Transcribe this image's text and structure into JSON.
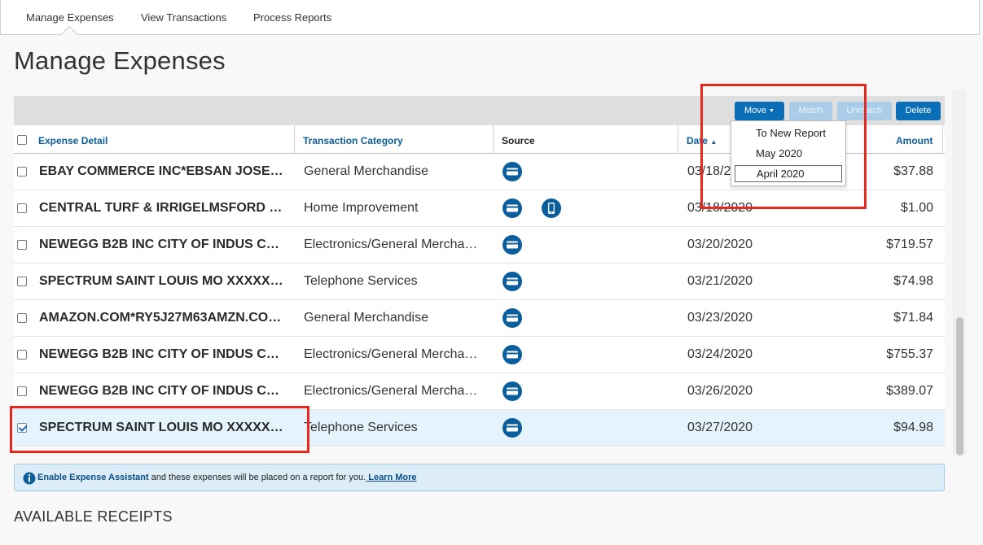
{
  "nav": {
    "tabs": [
      "Manage Expenses",
      "View Transactions",
      "Process Reports"
    ]
  },
  "page": {
    "title": "Manage Expenses",
    "section_title": "AVAILABLE RECEIPTS"
  },
  "toolbar": {
    "move_label": "Move",
    "match_label": "Match",
    "unmatch_label": "Unmatch",
    "delete_label": "Delete"
  },
  "move_menu": {
    "options": [
      "To New Report",
      "May 2020",
      "April 2020"
    ],
    "focused": "April 2020"
  },
  "table": {
    "headers": {
      "detail": "Expense Detail",
      "category": "Transaction Category",
      "source": "Source",
      "date": "Date",
      "amount": "Amount"
    },
    "sort": {
      "column": "Date",
      "direction": "ascending"
    },
    "rows": [
      {
        "detail": "EBAY COMMERCE INC*EBSAN JOSE…",
        "category": "General Merchandise",
        "sources": [
          "card-icon"
        ],
        "date": "03/18/2020",
        "amount": "$37.88",
        "checked": false
      },
      {
        "detail": "CENTRAL TURF & IRRIGELMSFORD …",
        "category": "Home Improvement",
        "sources": [
          "card-icon",
          "mobile-icon"
        ],
        "date": "03/18/2020",
        "amount": "$1.00",
        "checked": false
      },
      {
        "detail": "NEWEGG B2B INC CITY OF INDUS C…",
        "category": "Electronics/General Mercha…",
        "sources": [
          "card-icon"
        ],
        "date": "03/20/2020",
        "amount": "$719.57",
        "checked": false
      },
      {
        "detail": "SPECTRUM SAINT LOUIS MO XXXXX…",
        "category": "Telephone Services",
        "sources": [
          "card-icon"
        ],
        "date": "03/21/2020",
        "amount": "$74.98",
        "checked": false
      },
      {
        "detail": "AMAZON.COM*RY5J27M63AMZN.CO…",
        "category": "General Merchandise",
        "sources": [
          "card-icon"
        ],
        "date": "03/23/2020",
        "amount": "$71.84",
        "checked": false
      },
      {
        "detail": "NEWEGG B2B INC CITY OF INDUS C…",
        "category": "Electronics/General Mercha…",
        "sources": [
          "card-icon"
        ],
        "date": "03/24/2020",
        "amount": "$755.37",
        "checked": false
      },
      {
        "detail": "NEWEGG B2B INC CITY OF INDUS C…",
        "category": "Electronics/General Mercha…",
        "sources": [
          "card-icon"
        ],
        "date": "03/26/2020",
        "amount": "$389.07",
        "checked": false
      },
      {
        "detail": "SPECTRUM SAINT LOUIS MO XXXXX…",
        "category": "Telephone Services",
        "sources": [
          "card-icon"
        ],
        "date": "03/27/2020",
        "amount": "$94.98",
        "checked": true
      }
    ]
  },
  "info": {
    "strong": "Enable Expense Assistant",
    "text": " and these expenses will be placed on a report for you.",
    "link": " Learn More"
  },
  "colors": {
    "accent": "#0b6fb8",
    "link": "#0b5e9c",
    "highlight": "#e8271f",
    "selected_row": "#e4f3fc"
  }
}
